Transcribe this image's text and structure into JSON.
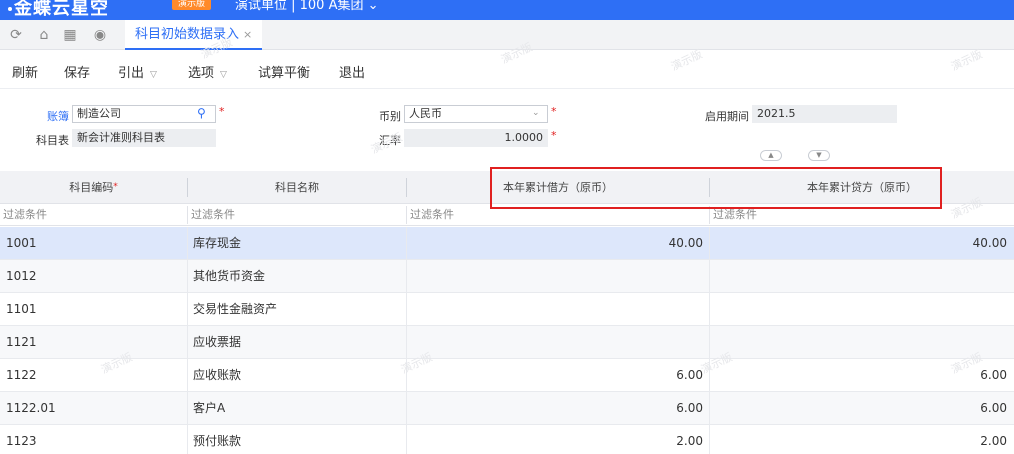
{
  "topbar": {
    "logo_text": "金蝶云星空",
    "badge": "演示版",
    "org_name": "演试单位 | 100 A集团"
  },
  "tabbar": {
    "nav_icons": [
      "refresh-icon",
      "home-icon",
      "apps-icon",
      "chat-icon"
    ],
    "active_tab": "科目初始数据录入",
    "close_glyph": "×"
  },
  "toolbar": {
    "items": [
      {
        "label": "刷新",
        "dropdown": false
      },
      {
        "label": "保存",
        "dropdown": false
      },
      {
        "label": "引出",
        "dropdown": true
      },
      {
        "label": "选项",
        "dropdown": true
      },
      {
        "label": "试算平衡",
        "dropdown": false
      },
      {
        "label": "退出",
        "dropdown": false
      }
    ]
  },
  "form": {
    "account_book_label": "账簿",
    "account_book_value": "制造公司",
    "chart_label": "科目表",
    "chart_value": "新会计准则科目表",
    "currency_label": "币别",
    "currency_value": "人民币",
    "rate_label": "汇率",
    "rate_value": "1.0000",
    "period_label": "启用期间",
    "period_value": "2021.5",
    "required_mark": "*"
  },
  "pager": {
    "up": "▲",
    "down": "▼"
  },
  "grid": {
    "columns": [
      {
        "label": "科目编码",
        "required": true
      },
      {
        "label": "科目名称",
        "required": false
      },
      {
        "label": "本年累计借方（原币）",
        "required": false
      },
      {
        "label": "本年累计贷方（原币）",
        "required": false
      }
    ],
    "filter_placeholder": "过滤条件",
    "rows": [
      {
        "code": "1001",
        "name": "库存现金",
        "debit": "40.00",
        "credit": "40.00",
        "selected": true
      },
      {
        "code": "1012",
        "name": "其他货币资金",
        "debit": "",
        "credit": ""
      },
      {
        "code": "1101",
        "name": "交易性金融资产",
        "debit": "",
        "credit": ""
      },
      {
        "code": "1121",
        "name": "应收票据",
        "debit": "",
        "credit": ""
      },
      {
        "code": "1122",
        "name": "应收账款",
        "debit": "6.00",
        "credit": "6.00"
      },
      {
        "code": "1122.01",
        "name": "客户A",
        "debit": "6.00",
        "credit": "6.00"
      },
      {
        "code": "1123",
        "name": "预付账款",
        "debit": "2.00",
        "credit": "2.00"
      }
    ]
  },
  "watermark_text": "演示版",
  "colors": {
    "brand_blue": "#2e6ff5",
    "badge_orange": "#ff8a2a",
    "required_red": "#e02020",
    "highlight_red": "#e02020",
    "selected_row": "#dde7fb"
  }
}
